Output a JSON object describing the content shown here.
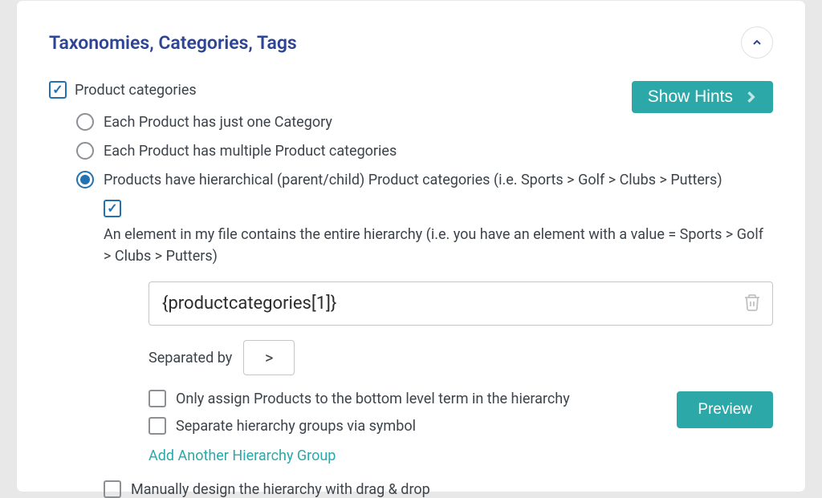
{
  "panel": {
    "title": "Taxonomies, Categories, Tags"
  },
  "showHints": "Show Hints",
  "productCategories": {
    "label": "Product categories"
  },
  "radios": {
    "one": "Each Product has just one Category",
    "multiple": "Each Product has multiple Product categories",
    "hierarchical": "Products have hierarchical (parent/child) Product categories (i.e. Sports > Golf > Clubs > Putters)"
  },
  "hierarchy": {
    "desc": "An element in my file contains the entire hierarchy (i.e. you have an element with a value = Sports > Golf > Clubs > Putters)",
    "fieldValue": "{productcategories[1]}",
    "separatedBy": "Separated by",
    "separator": ">",
    "bottomOnly": "Only assign Products to the bottom level term in the hierarchy",
    "separateGroups": "Separate hierarchy groups via symbol",
    "addAnother": "Add Another Hierarchy Group"
  },
  "preview": "Preview",
  "manual": "Manually design the hierarchy with drag & drop"
}
